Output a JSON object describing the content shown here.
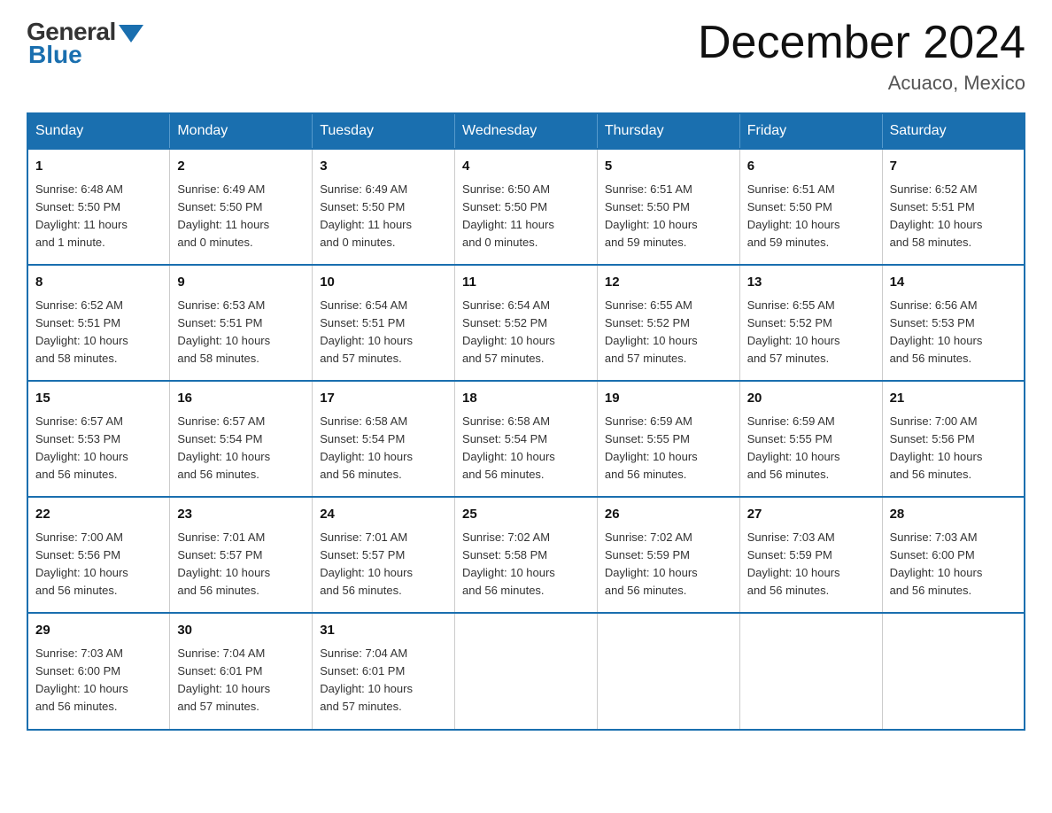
{
  "logo": {
    "general": "General",
    "blue": "Blue"
  },
  "header": {
    "title": "December 2024",
    "location": "Acuaco, Mexico"
  },
  "days_of_week": [
    "Sunday",
    "Monday",
    "Tuesday",
    "Wednesday",
    "Thursday",
    "Friday",
    "Saturday"
  ],
  "weeks": [
    [
      {
        "day": "1",
        "sunrise": "6:48 AM",
        "sunset": "5:50 PM",
        "daylight": "11 hours and 1 minute."
      },
      {
        "day": "2",
        "sunrise": "6:49 AM",
        "sunset": "5:50 PM",
        "daylight": "11 hours and 0 minutes."
      },
      {
        "day": "3",
        "sunrise": "6:49 AM",
        "sunset": "5:50 PM",
        "daylight": "11 hours and 0 minutes."
      },
      {
        "day": "4",
        "sunrise": "6:50 AM",
        "sunset": "5:50 PM",
        "daylight": "11 hours and 0 minutes."
      },
      {
        "day": "5",
        "sunrise": "6:51 AM",
        "sunset": "5:50 PM",
        "daylight": "10 hours and 59 minutes."
      },
      {
        "day": "6",
        "sunrise": "6:51 AM",
        "sunset": "5:50 PM",
        "daylight": "10 hours and 59 minutes."
      },
      {
        "day": "7",
        "sunrise": "6:52 AM",
        "sunset": "5:51 PM",
        "daylight": "10 hours and 58 minutes."
      }
    ],
    [
      {
        "day": "8",
        "sunrise": "6:52 AM",
        "sunset": "5:51 PM",
        "daylight": "10 hours and 58 minutes."
      },
      {
        "day": "9",
        "sunrise": "6:53 AM",
        "sunset": "5:51 PM",
        "daylight": "10 hours and 58 minutes."
      },
      {
        "day": "10",
        "sunrise": "6:54 AM",
        "sunset": "5:51 PM",
        "daylight": "10 hours and 57 minutes."
      },
      {
        "day": "11",
        "sunrise": "6:54 AM",
        "sunset": "5:52 PM",
        "daylight": "10 hours and 57 minutes."
      },
      {
        "day": "12",
        "sunrise": "6:55 AM",
        "sunset": "5:52 PM",
        "daylight": "10 hours and 57 minutes."
      },
      {
        "day": "13",
        "sunrise": "6:55 AM",
        "sunset": "5:52 PM",
        "daylight": "10 hours and 57 minutes."
      },
      {
        "day": "14",
        "sunrise": "6:56 AM",
        "sunset": "5:53 PM",
        "daylight": "10 hours and 56 minutes."
      }
    ],
    [
      {
        "day": "15",
        "sunrise": "6:57 AM",
        "sunset": "5:53 PM",
        "daylight": "10 hours and 56 minutes."
      },
      {
        "day": "16",
        "sunrise": "6:57 AM",
        "sunset": "5:54 PM",
        "daylight": "10 hours and 56 minutes."
      },
      {
        "day": "17",
        "sunrise": "6:58 AM",
        "sunset": "5:54 PM",
        "daylight": "10 hours and 56 minutes."
      },
      {
        "day": "18",
        "sunrise": "6:58 AM",
        "sunset": "5:54 PM",
        "daylight": "10 hours and 56 minutes."
      },
      {
        "day": "19",
        "sunrise": "6:59 AM",
        "sunset": "5:55 PM",
        "daylight": "10 hours and 56 minutes."
      },
      {
        "day": "20",
        "sunrise": "6:59 AM",
        "sunset": "5:55 PM",
        "daylight": "10 hours and 56 minutes."
      },
      {
        "day": "21",
        "sunrise": "7:00 AM",
        "sunset": "5:56 PM",
        "daylight": "10 hours and 56 minutes."
      }
    ],
    [
      {
        "day": "22",
        "sunrise": "7:00 AM",
        "sunset": "5:56 PM",
        "daylight": "10 hours and 56 minutes."
      },
      {
        "day": "23",
        "sunrise": "7:01 AM",
        "sunset": "5:57 PM",
        "daylight": "10 hours and 56 minutes."
      },
      {
        "day": "24",
        "sunrise": "7:01 AM",
        "sunset": "5:57 PM",
        "daylight": "10 hours and 56 minutes."
      },
      {
        "day": "25",
        "sunrise": "7:02 AM",
        "sunset": "5:58 PM",
        "daylight": "10 hours and 56 minutes."
      },
      {
        "day": "26",
        "sunrise": "7:02 AM",
        "sunset": "5:59 PM",
        "daylight": "10 hours and 56 minutes."
      },
      {
        "day": "27",
        "sunrise": "7:03 AM",
        "sunset": "5:59 PM",
        "daylight": "10 hours and 56 minutes."
      },
      {
        "day": "28",
        "sunrise": "7:03 AM",
        "sunset": "6:00 PM",
        "daylight": "10 hours and 56 minutes."
      }
    ],
    [
      {
        "day": "29",
        "sunrise": "7:03 AM",
        "sunset": "6:00 PM",
        "daylight": "10 hours and 56 minutes."
      },
      {
        "day": "30",
        "sunrise": "7:04 AM",
        "sunset": "6:01 PM",
        "daylight": "10 hours and 57 minutes."
      },
      {
        "day": "31",
        "sunrise": "7:04 AM",
        "sunset": "6:01 PM",
        "daylight": "10 hours and 57 minutes."
      },
      null,
      null,
      null,
      null
    ]
  ],
  "labels": {
    "sunrise": "Sunrise:",
    "sunset": "Sunset:",
    "daylight": "Daylight:"
  }
}
